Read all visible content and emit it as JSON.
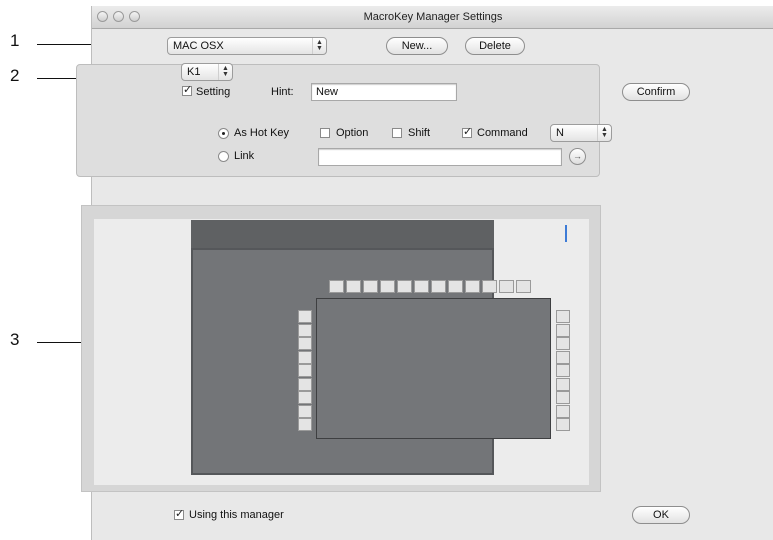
{
  "callouts": [
    "1",
    "2",
    "3"
  ],
  "window": {
    "title": "MacroKey Manager Settings"
  },
  "toolbar": {
    "os_select": "MAC OSX",
    "new_label": "New...",
    "delete_label": "Delete"
  },
  "key_group": {
    "key_select": "K1",
    "setting_label": "Setting",
    "setting_checked": true,
    "hint_label": "Hint:",
    "hint_value": "New",
    "confirm_label": "Confirm",
    "as_hotkey_label": "As Hot Key",
    "as_hotkey_selected": true,
    "option_label": "Option",
    "option_checked": false,
    "shift_label": "Shift",
    "shift_checked": false,
    "command_label": "Command",
    "command_checked": true,
    "key_value": "N",
    "link_label": "Link",
    "link_selected": false,
    "link_value": ""
  },
  "preview": {
    "top_key_count": 12,
    "side_key_count": 9
  },
  "footer": {
    "using_manager_label": "Using this manager",
    "using_manager_checked": true,
    "ok_label": "OK"
  },
  "icons": {
    "arrows": "up-down-arrows-icon",
    "checkmark": "checkmark-icon",
    "link_go": "arrow-right-icon"
  }
}
